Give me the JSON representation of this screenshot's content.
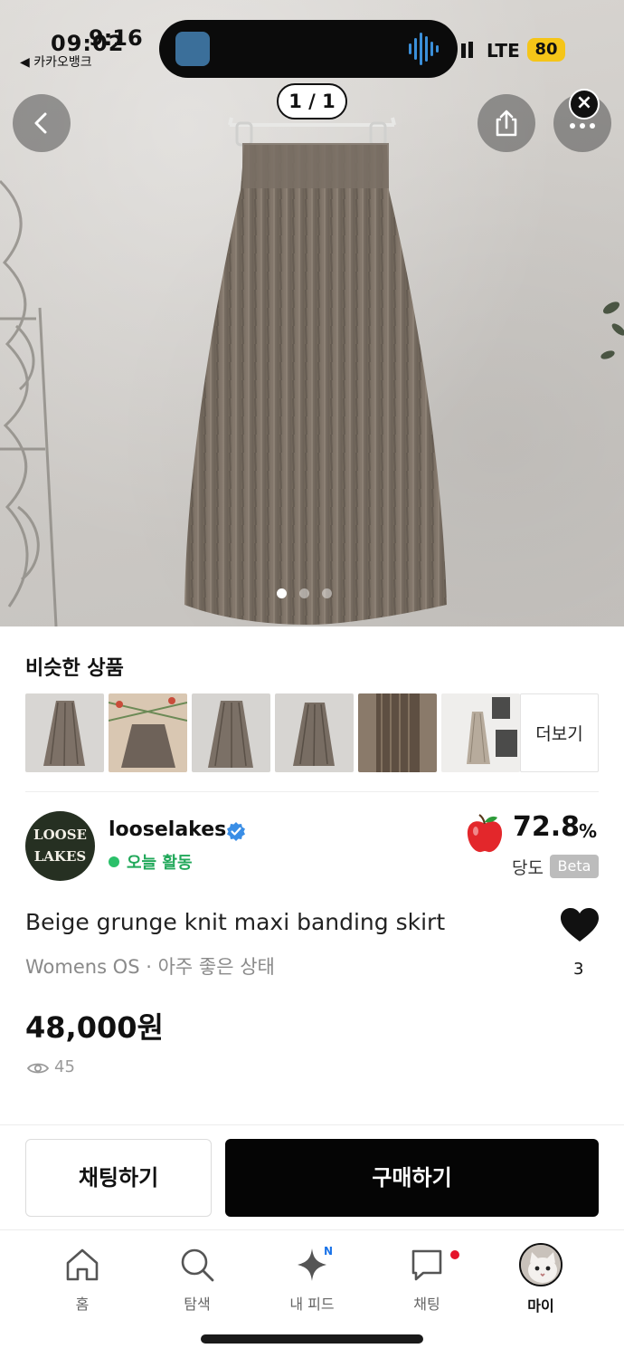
{
  "status_bar": {
    "time_behind": "09:02",
    "time_front": "9:16",
    "back_app": "◀ 카카오뱅크",
    "network": "LTE",
    "battery": "80"
  },
  "gallery": {
    "counter": "1 / 1",
    "dots_total": 3,
    "active_dot": 1
  },
  "similar": {
    "title": "비슷한 상품",
    "more_label": "더보기",
    "item_count": 6
  },
  "seller": {
    "avatar_line1": "LOOSE",
    "avatar_line2": "LAKES",
    "name": "looselakes",
    "activity": "오늘 활동",
    "score": "72.8",
    "score_unit": "%",
    "score_label": "당도",
    "beta": "Beta"
  },
  "product": {
    "title": "Beige grunge knit maxi banding skirt",
    "subtitle": "Womens OS · 아주 좋은 상태",
    "price": "48,000원",
    "views": "45",
    "likes": "3"
  },
  "actions": {
    "chat": "채팅하기",
    "buy": "구매하기"
  },
  "tabs": {
    "home": "홈",
    "search": "탐색",
    "feed": "내 피드",
    "feed_badge": "N",
    "chat": "채팅",
    "my": "마이"
  },
  "colors": {
    "accent_green": "#21a85a",
    "buy_button": "#050505",
    "verified_blue": "#3a8ee6",
    "apple_red": "#e3272b",
    "badge_red": "#e5142b"
  }
}
